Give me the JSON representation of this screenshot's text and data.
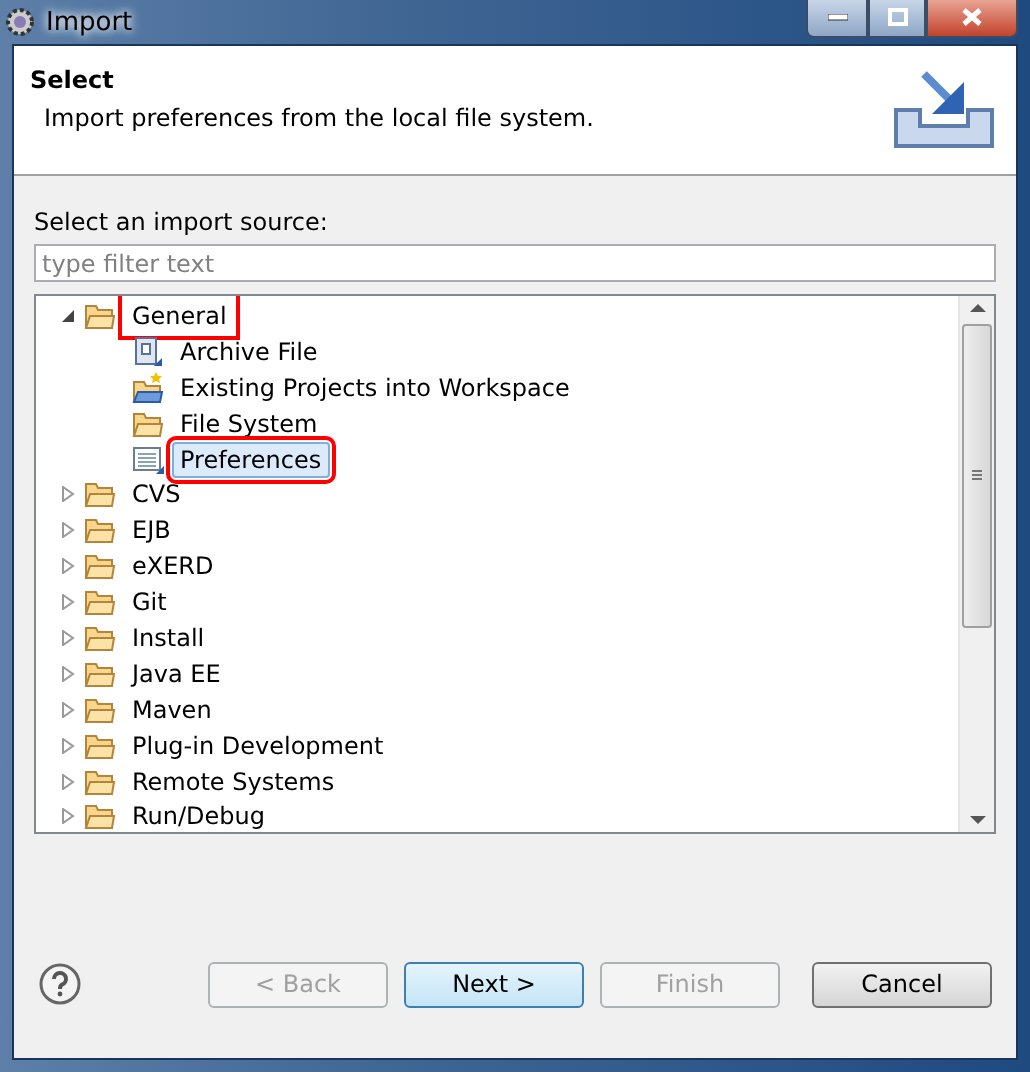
{
  "window": {
    "title": "Import"
  },
  "header": {
    "title": "Select",
    "description": "Import preferences from the local file system."
  },
  "source_label": "Select an import source:",
  "filter": {
    "placeholder": "type filter text"
  },
  "tree": [
    {
      "label": "General",
      "kind": "folder",
      "expanded": true,
      "selected": false,
      "highlighted": true,
      "children": [
        {
          "label": "Archive File",
          "kind": "archive",
          "selected": false,
          "highlighted": false
        },
        {
          "label": "Existing Projects into Workspace",
          "kind": "project",
          "selected": false,
          "highlighted": false
        },
        {
          "label": "File System",
          "kind": "folder",
          "selected": false,
          "highlighted": false
        },
        {
          "label": "Preferences",
          "kind": "preferences",
          "selected": true,
          "highlighted": true
        }
      ]
    },
    {
      "label": "CVS",
      "kind": "folder",
      "expanded": false,
      "selected": false,
      "highlighted": false
    },
    {
      "label": "EJB",
      "kind": "folder",
      "expanded": false,
      "selected": false,
      "highlighted": false
    },
    {
      "label": "eXERD",
      "kind": "folder",
      "expanded": false,
      "selected": false,
      "highlighted": false
    },
    {
      "label": "Git",
      "kind": "folder",
      "expanded": false,
      "selected": false,
      "highlighted": false
    },
    {
      "label": "Install",
      "kind": "folder",
      "expanded": false,
      "selected": false,
      "highlighted": false
    },
    {
      "label": "Java EE",
      "kind": "folder",
      "expanded": false,
      "selected": false,
      "highlighted": false
    },
    {
      "label": "Maven",
      "kind": "folder",
      "expanded": false,
      "selected": false,
      "highlighted": false
    },
    {
      "label": "Plug-in Development",
      "kind": "folder",
      "expanded": false,
      "selected": false,
      "highlighted": false
    },
    {
      "label": "Remote Systems",
      "kind": "folder",
      "expanded": false,
      "selected": false,
      "highlighted": false
    },
    {
      "label": "Run/Debug",
      "kind": "folder",
      "expanded": false,
      "selected": false,
      "highlighted": false
    }
  ],
  "buttons": [
    {
      "label": "< Back",
      "disabled": true,
      "default": false
    },
    {
      "label": "Next >",
      "disabled": false,
      "default": true
    },
    {
      "label": "Finish",
      "disabled": true,
      "default": false
    },
    {
      "label": "Cancel",
      "disabled": false,
      "default": false
    }
  ]
}
